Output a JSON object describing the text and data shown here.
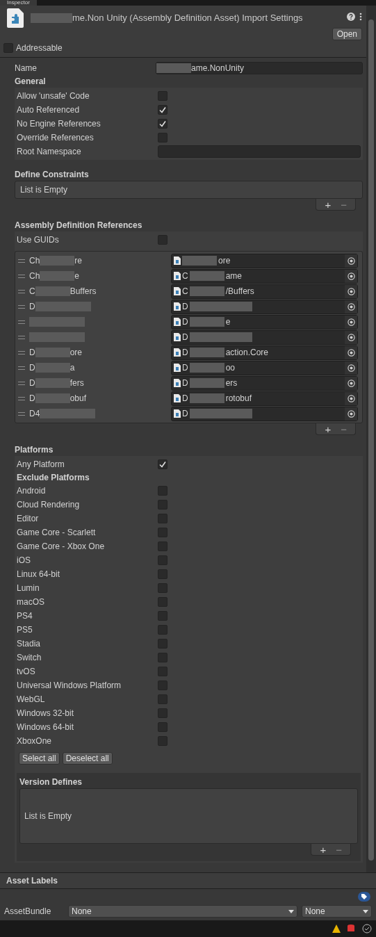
{
  "tab": "Inspector",
  "header": {
    "title": "me.Non Unity (Assembly Definition Asset) Import Settings",
    "open_button": "Open",
    "addressable": {
      "label": "Addressable",
      "checked": false
    }
  },
  "name_field": {
    "label": "Name",
    "value": "ame.NonUnity"
  },
  "general": {
    "title": "General",
    "options": [
      {
        "kind": "toggle",
        "label": "Allow 'unsafe' Code",
        "checked": false
      },
      {
        "kind": "toggle",
        "label": "Auto Referenced",
        "checked": true
      },
      {
        "kind": "toggle",
        "label": "No Engine References",
        "checked": true
      },
      {
        "kind": "toggle",
        "label": "Override References",
        "checked": false
      },
      {
        "kind": "text",
        "label": "Root Namespace"
      }
    ]
  },
  "define_constraints": {
    "title": "Define Constraints",
    "empty_text": "List is Empty",
    "add": "+",
    "remove": "−"
  },
  "references": {
    "title": "Assembly Definition References",
    "use_guids": {
      "label": "Use GUIDs",
      "checked": false
    },
    "items": [
      {
        "name_start": "Ch",
        "name_end": "re",
        "ref_end": "ore"
      },
      {
        "name_start": "Ch",
        "name_end": "e",
        "ref_start": "C",
        "ref_end": "ame"
      },
      {
        "name_start": "C",
        "name_end": "Buffers",
        "ref_start": "C",
        "ref_end": "/Buffers"
      },
      {
        "name_start": "D",
        "ref_start": "D"
      },
      {
        "ref_start": "D",
        "ref_end": "e"
      },
      {
        "ref_start": "D"
      },
      {
        "name_start": "D",
        "name_end": "ore",
        "ref_start": "D",
        "ref_end": "action.Core"
      },
      {
        "name_start": "D",
        "name_end": "a",
        "ref_start": "D",
        "ref_end": "oo"
      },
      {
        "name_start": "D",
        "name_end": "fers",
        "ref_start": "D",
        "ref_end": "ers"
      },
      {
        "name_start": "D",
        "name_end": "obuf",
        "ref_start": "D",
        "ref_end": "rotobuf"
      },
      {
        "name_start": "D4",
        "ref_start": "D"
      }
    ],
    "add": "+",
    "remove": "−"
  },
  "platforms": {
    "title": "Platforms",
    "any_platform": {
      "label": "Any Platform",
      "checked": true
    },
    "exclude_title": "Exclude Platforms",
    "items": [
      {
        "label": "Android",
        "checked": false
      },
      {
        "label": "Cloud Rendering",
        "checked": false
      },
      {
        "label": "Editor",
        "checked": false
      },
      {
        "label": "Game Core - Scarlett",
        "checked": false
      },
      {
        "label": "Game Core - Xbox One",
        "checked": false
      },
      {
        "label": "iOS",
        "checked": false
      },
      {
        "label": "Linux 64-bit",
        "checked": false
      },
      {
        "label": "Lumin",
        "checked": false
      },
      {
        "label": "macOS",
        "checked": false
      },
      {
        "label": "PS4",
        "checked": false
      },
      {
        "label": "PS5",
        "checked": false
      },
      {
        "label": "Stadia",
        "checked": false
      },
      {
        "label": "Switch",
        "checked": false
      },
      {
        "label": "tvOS",
        "checked": false
      },
      {
        "label": "Universal Windows Platform",
        "checked": false
      },
      {
        "label": "WebGL",
        "checked": false
      },
      {
        "label": "Windows 32-bit",
        "checked": false
      },
      {
        "label": "Windows 64-bit",
        "checked": false
      },
      {
        "label": "XboxOne",
        "checked": false
      }
    ],
    "buttons": [
      "Select all",
      "Deselect all"
    ]
  },
  "version_defines": {
    "title": "Version Defines",
    "empty_text": "List is Empty",
    "add": "+",
    "remove": "−"
  },
  "asset_labels": {
    "title": "Asset Labels"
  },
  "asset_bundle": {
    "label": "AssetBundle",
    "name": "None",
    "variant": "None"
  }
}
